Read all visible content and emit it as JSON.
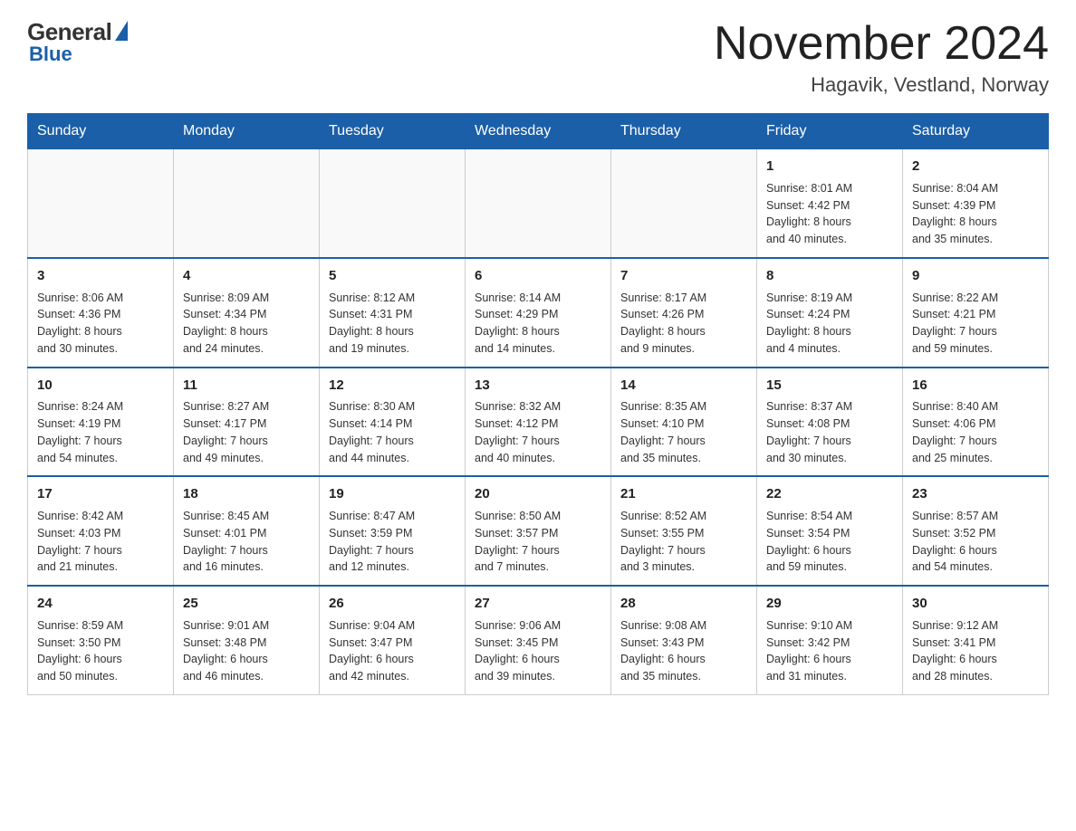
{
  "logo": {
    "general": "General",
    "blue": "Blue"
  },
  "title": "November 2024",
  "location": "Hagavik, Vestland, Norway",
  "weekdays": [
    "Sunday",
    "Monday",
    "Tuesday",
    "Wednesday",
    "Thursday",
    "Friday",
    "Saturday"
  ],
  "weeks": [
    [
      {
        "day": "",
        "info": ""
      },
      {
        "day": "",
        "info": ""
      },
      {
        "day": "",
        "info": ""
      },
      {
        "day": "",
        "info": ""
      },
      {
        "day": "",
        "info": ""
      },
      {
        "day": "1",
        "info": "Sunrise: 8:01 AM\nSunset: 4:42 PM\nDaylight: 8 hours\nand 40 minutes."
      },
      {
        "day": "2",
        "info": "Sunrise: 8:04 AM\nSunset: 4:39 PM\nDaylight: 8 hours\nand 35 minutes."
      }
    ],
    [
      {
        "day": "3",
        "info": "Sunrise: 8:06 AM\nSunset: 4:36 PM\nDaylight: 8 hours\nand 30 minutes."
      },
      {
        "day": "4",
        "info": "Sunrise: 8:09 AM\nSunset: 4:34 PM\nDaylight: 8 hours\nand 24 minutes."
      },
      {
        "day": "5",
        "info": "Sunrise: 8:12 AM\nSunset: 4:31 PM\nDaylight: 8 hours\nand 19 minutes."
      },
      {
        "day": "6",
        "info": "Sunrise: 8:14 AM\nSunset: 4:29 PM\nDaylight: 8 hours\nand 14 minutes."
      },
      {
        "day": "7",
        "info": "Sunrise: 8:17 AM\nSunset: 4:26 PM\nDaylight: 8 hours\nand 9 minutes."
      },
      {
        "day": "8",
        "info": "Sunrise: 8:19 AM\nSunset: 4:24 PM\nDaylight: 8 hours\nand 4 minutes."
      },
      {
        "day": "9",
        "info": "Sunrise: 8:22 AM\nSunset: 4:21 PM\nDaylight: 7 hours\nand 59 minutes."
      }
    ],
    [
      {
        "day": "10",
        "info": "Sunrise: 8:24 AM\nSunset: 4:19 PM\nDaylight: 7 hours\nand 54 minutes."
      },
      {
        "day": "11",
        "info": "Sunrise: 8:27 AM\nSunset: 4:17 PM\nDaylight: 7 hours\nand 49 minutes."
      },
      {
        "day": "12",
        "info": "Sunrise: 8:30 AM\nSunset: 4:14 PM\nDaylight: 7 hours\nand 44 minutes."
      },
      {
        "day": "13",
        "info": "Sunrise: 8:32 AM\nSunset: 4:12 PM\nDaylight: 7 hours\nand 40 minutes."
      },
      {
        "day": "14",
        "info": "Sunrise: 8:35 AM\nSunset: 4:10 PM\nDaylight: 7 hours\nand 35 minutes."
      },
      {
        "day": "15",
        "info": "Sunrise: 8:37 AM\nSunset: 4:08 PM\nDaylight: 7 hours\nand 30 minutes."
      },
      {
        "day": "16",
        "info": "Sunrise: 8:40 AM\nSunset: 4:06 PM\nDaylight: 7 hours\nand 25 minutes."
      }
    ],
    [
      {
        "day": "17",
        "info": "Sunrise: 8:42 AM\nSunset: 4:03 PM\nDaylight: 7 hours\nand 21 minutes."
      },
      {
        "day": "18",
        "info": "Sunrise: 8:45 AM\nSunset: 4:01 PM\nDaylight: 7 hours\nand 16 minutes."
      },
      {
        "day": "19",
        "info": "Sunrise: 8:47 AM\nSunset: 3:59 PM\nDaylight: 7 hours\nand 12 minutes."
      },
      {
        "day": "20",
        "info": "Sunrise: 8:50 AM\nSunset: 3:57 PM\nDaylight: 7 hours\nand 7 minutes."
      },
      {
        "day": "21",
        "info": "Sunrise: 8:52 AM\nSunset: 3:55 PM\nDaylight: 7 hours\nand 3 minutes."
      },
      {
        "day": "22",
        "info": "Sunrise: 8:54 AM\nSunset: 3:54 PM\nDaylight: 6 hours\nand 59 minutes."
      },
      {
        "day": "23",
        "info": "Sunrise: 8:57 AM\nSunset: 3:52 PM\nDaylight: 6 hours\nand 54 minutes."
      }
    ],
    [
      {
        "day": "24",
        "info": "Sunrise: 8:59 AM\nSunset: 3:50 PM\nDaylight: 6 hours\nand 50 minutes."
      },
      {
        "day": "25",
        "info": "Sunrise: 9:01 AM\nSunset: 3:48 PM\nDaylight: 6 hours\nand 46 minutes."
      },
      {
        "day": "26",
        "info": "Sunrise: 9:04 AM\nSunset: 3:47 PM\nDaylight: 6 hours\nand 42 minutes."
      },
      {
        "day": "27",
        "info": "Sunrise: 9:06 AM\nSunset: 3:45 PM\nDaylight: 6 hours\nand 39 minutes."
      },
      {
        "day": "28",
        "info": "Sunrise: 9:08 AM\nSunset: 3:43 PM\nDaylight: 6 hours\nand 35 minutes."
      },
      {
        "day": "29",
        "info": "Sunrise: 9:10 AM\nSunset: 3:42 PM\nDaylight: 6 hours\nand 31 minutes."
      },
      {
        "day": "30",
        "info": "Sunrise: 9:12 AM\nSunset: 3:41 PM\nDaylight: 6 hours\nand 28 minutes."
      }
    ]
  ]
}
